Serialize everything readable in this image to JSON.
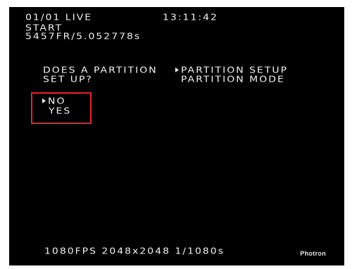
{
  "header": {
    "frame_status": "01/01 LIVE",
    "clock": "13:11:42",
    "trigger_mode": "START",
    "frame_info": "5457FR/5.052778s"
  },
  "question": {
    "line1": "DOES A PARTITION",
    "line2": "SET UP?"
  },
  "breadcrumb": {
    "menu": "PARTITION SETUP",
    "item": "PARTITION MODE"
  },
  "options": [
    {
      "label": "NO",
      "selected": true
    },
    {
      "label": "YES",
      "selected": false
    }
  ],
  "footer": {
    "recording_info": "1080FPS 2048x2048 1/1080s",
    "brand": "Photron"
  },
  "colors": {
    "screen_bg": "#000000",
    "text": "#f2f2f2",
    "highlight_box": "#e2262a"
  }
}
